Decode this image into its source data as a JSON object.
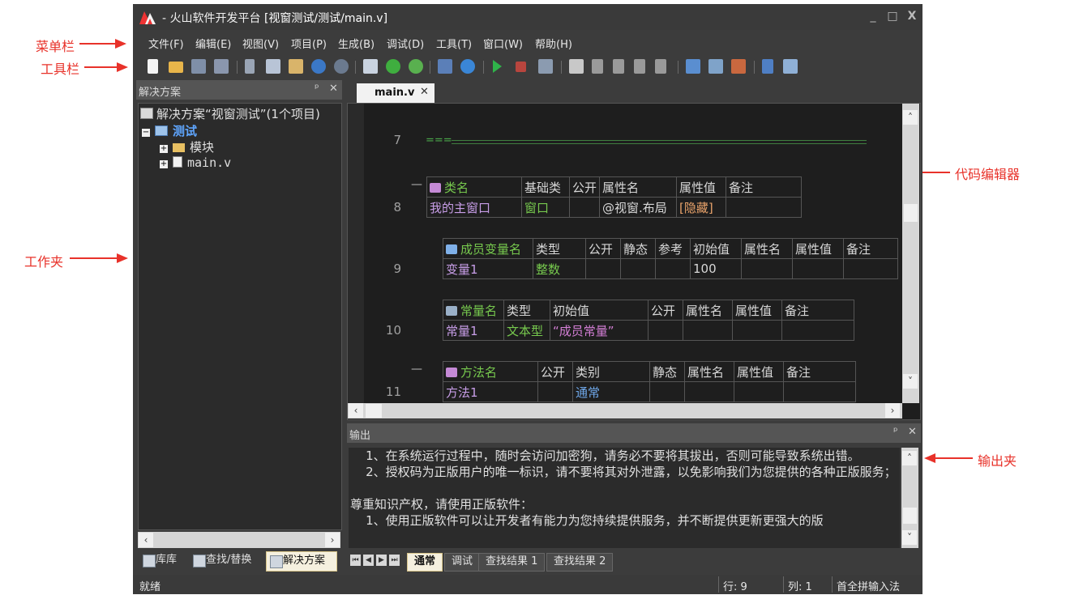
{
  "annotations": {
    "menubar": "菜单栏",
    "toolbar": "工具栏",
    "workfolder": "工作夹",
    "code_editor": "代码编辑器",
    "output_folder": "输出夹"
  },
  "window": {
    "title_prefix": " - 火山软件开发平台 ",
    "title_path": "[视窗测试/测试/main.v]",
    "minimize": "_",
    "maximize": "□",
    "close": "X"
  },
  "menu": [
    "文件(F)",
    "编辑(E)",
    "视图(V)",
    "项目(P)",
    "生成(B)",
    "调试(D)",
    "工具(T)",
    "窗口(W)",
    "帮助(H)"
  ],
  "solution_panel": {
    "title": "解决方案",
    "pin": "ᵖ",
    "close": "✕",
    "tree": {
      "root": "解决方案“视窗测试”(1个项目)",
      "project": "测试",
      "folder": "模块",
      "file": "main.v",
      "expanded_glyph": "−",
      "collapsed_glyph": "+"
    }
  },
  "left_tabs": [
    "库库",
    "查找/替换",
    "解决方案"
  ],
  "editor": {
    "tab_label": "main.v",
    "tab_close": "✕",
    "lines": {
      "l7": "7",
      "l7_text": "===",
      "l8": "8",
      "l9": "9",
      "l10": "10",
      "l11": "11",
      "fold": "—"
    },
    "class_table": {
      "headers": [
        "类名",
        "基础类",
        "公开",
        "属性名",
        "属性值",
        "备注"
      ],
      "row": [
        "我的主窗口",
        "窗口",
        "",
        "@视窗.布局",
        "[隐藏]",
        ""
      ]
    },
    "member_table": {
      "headers": [
        "成员变量名",
        "类型",
        "公开",
        "静态",
        "参考",
        "初始值",
        "属性名",
        "属性值",
        "备注"
      ],
      "row": [
        "变量1",
        "整数",
        "",
        "",
        "",
        "100",
        "",
        "",
        ""
      ]
    },
    "const_table": {
      "headers": [
        "常量名",
        "类型",
        "初始值",
        "公开",
        "属性名",
        "属性值",
        "备注"
      ],
      "row": [
        "常量1",
        "文本型",
        "“成员常量”",
        "",
        "",
        "",
        ""
      ]
    },
    "method_table": {
      "headers": [
        "方法名",
        "公开",
        "类别",
        "静态",
        "属性名",
        "属性值",
        "备注"
      ],
      "row": [
        "方法1",
        "",
        "通常",
        "",
        "",
        "",
        ""
      ]
    }
  },
  "output_panel": {
    "title": "输出",
    "lines": [
      "    1、在系统运行过程中，随时会访问加密狗，请务必不要将其拔出，否则可能导致系统出错。",
      "    2、授权码为正版用户的唯一标识，请不要将其对外泄露，以免影响我们为您提供的各种正版服务；",
      "",
      "尊重知识产权，请使用正版软件：",
      "    1、使用正版软件可以让开发者有能力为您持续提供服务，并不断提供更新更强大的版"
    ],
    "tabs": [
      "通常",
      "调试",
      "查找结果 1",
      "查找结果 2"
    ]
  },
  "status": {
    "ready": "就绪",
    "row": "行: 9",
    "col": "列: 1",
    "ime": "首全拼输入法"
  }
}
